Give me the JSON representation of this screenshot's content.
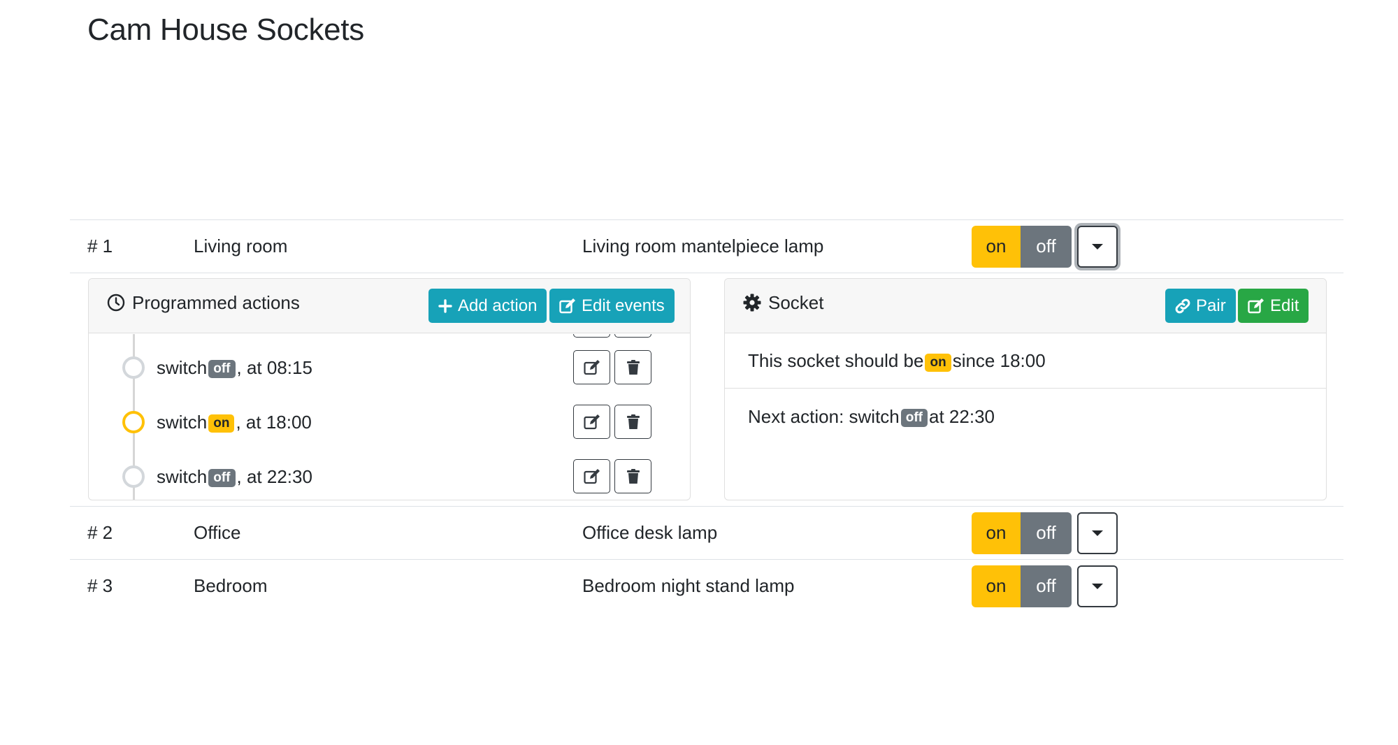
{
  "page": {
    "title": "Cam House Sockets"
  },
  "colors": {
    "on": "#ffc107",
    "off": "#6c757d",
    "info": "#17a2b8",
    "success": "#28a745"
  },
  "rows": [
    {
      "num": "# 1",
      "room": "Living room",
      "name": "Living room mantelpiece lamp",
      "on_label": "on",
      "off_label": "off",
      "expanded": true
    },
    {
      "num": "# 2",
      "room": "Office",
      "name": "Office desk lamp",
      "on_label": "on",
      "off_label": "off",
      "expanded": false
    },
    {
      "num": "# 3",
      "room": "Bedroom",
      "name": "Bedroom night stand lamp",
      "on_label": "on",
      "off_label": "off",
      "expanded": false
    }
  ],
  "actions_card": {
    "title": "Programmed actions",
    "icon": "clock-icon",
    "add_label": "Add action",
    "edit_label": "Edit events",
    "items": [
      {
        "prefix": "switch",
        "state": "off",
        "suffix": ", at 08:15",
        "current": false
      },
      {
        "prefix": "switch",
        "state": "on",
        "suffix": ", at 18:00",
        "current": true
      },
      {
        "prefix": "switch",
        "state": "off",
        "suffix": ", at 22:30",
        "current": false
      }
    ]
  },
  "socket_card": {
    "title": "Socket",
    "icon": "gear-icon",
    "pair_label": "Pair",
    "edit_label": "Edit",
    "status_prefix": "This socket should be",
    "status_state": "on",
    "status_suffix": "since 18:00",
    "next_prefix": "Next action: switch",
    "next_state": "off",
    "next_suffix": "at 22:30"
  }
}
